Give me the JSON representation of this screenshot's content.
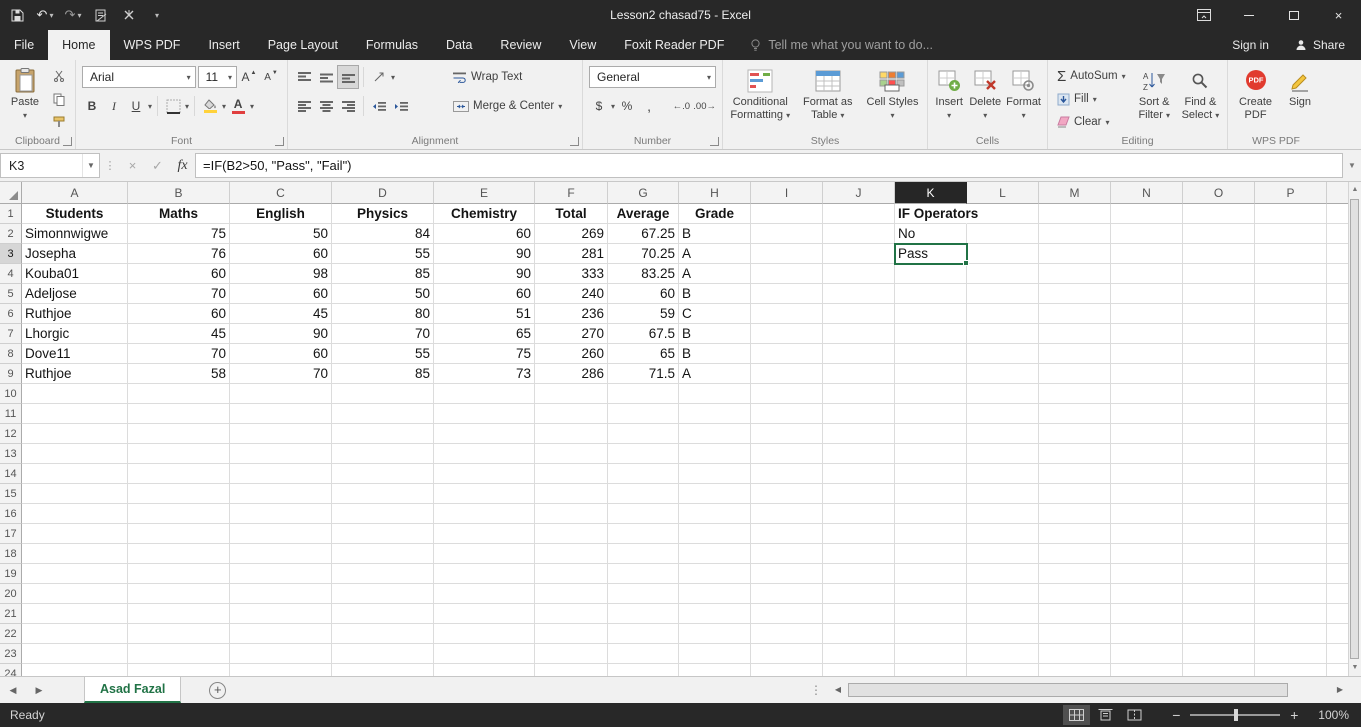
{
  "colors": {
    "accent_green": "#217346",
    "title_bar": "#282828",
    "ribbon_background": "#f1f1f1",
    "selected_column_header": "#262626",
    "selection_border": "#217346"
  },
  "titlebar": {
    "title": "Lesson2 chasad75 - Excel"
  },
  "menu": {
    "tabs": [
      {
        "label": "File"
      },
      {
        "label": "Home",
        "active": true
      },
      {
        "label": "WPS PDF"
      },
      {
        "label": "Insert"
      },
      {
        "label": "Page Layout"
      },
      {
        "label": "Formulas"
      },
      {
        "label": "Data"
      },
      {
        "label": "Review"
      },
      {
        "label": "View"
      },
      {
        "label": "Foxit Reader PDF"
      }
    ],
    "tell_me": "Tell me what you want to do...",
    "sign_in": "Sign in",
    "share": "Share"
  },
  "ribbon": {
    "groups": {
      "clipboard": {
        "label": "Clipboard",
        "paste": "Paste"
      },
      "font": {
        "label": "Font",
        "font_name": "Arial",
        "font_size": "11"
      },
      "alignment": {
        "label": "Alignment",
        "wrap_text": "Wrap Text",
        "merge_center": "Merge & Center"
      },
      "number": {
        "label": "Number",
        "format": "General"
      },
      "styles": {
        "label": "Styles",
        "conditional_formatting": "Conditional Formatting",
        "format_as_table": "Format as Table",
        "cell_styles": "Cell Styles"
      },
      "cells": {
        "label": "Cells",
        "insert": "Insert",
        "delete": "Delete",
        "format": "Format"
      },
      "editing": {
        "label": "Editing",
        "autosum": "AutoSum",
        "fill": "Fill",
        "clear": "Clear",
        "sort_filter": "Sort & Filter",
        "find_select": "Find & Select"
      },
      "wps": {
        "label": "WPS PDF",
        "create_pdf": "Create PDF",
        "sign": "Sign"
      }
    }
  },
  "formula_bar": {
    "name_box": "K3",
    "formula": "=IF(B2>50, \"Pass\", \"Fail\")"
  },
  "sheet": {
    "columns": [
      "A",
      "B",
      "C",
      "D",
      "E",
      "F",
      "G",
      "H",
      "I",
      "J",
      "K",
      "L",
      "M",
      "N",
      "O",
      "P"
    ],
    "visible_rows": 24,
    "selection": {
      "active_cell": "K3",
      "column": "K",
      "row": 3
    },
    "cells": [
      {
        "r": 1,
        "c": "A",
        "v": "Students",
        "a": "c",
        "b": true
      },
      {
        "r": 1,
        "c": "B",
        "v": "Maths",
        "a": "c",
        "b": true
      },
      {
        "r": 1,
        "c": "C",
        "v": "English",
        "a": "c",
        "b": true
      },
      {
        "r": 1,
        "c": "D",
        "v": "Physics",
        "a": "c",
        "b": true
      },
      {
        "r": 1,
        "c": "E",
        "v": "Chemistry",
        "a": "c",
        "b": true
      },
      {
        "r": 1,
        "c": "F",
        "v": "Total",
        "a": "c",
        "b": true
      },
      {
        "r": 1,
        "c": "G",
        "v": "Average",
        "a": "c",
        "b": true
      },
      {
        "r": 1,
        "c": "H",
        "v": "Grade",
        "a": "c",
        "b": true
      },
      {
        "r": 1,
        "c": "K",
        "v": "IF Operators",
        "a": "l",
        "b": true,
        "spill": true
      },
      {
        "r": 2,
        "c": "A",
        "v": "Simonnwigwe",
        "a": "l"
      },
      {
        "r": 2,
        "c": "B",
        "v": "75",
        "a": "r"
      },
      {
        "r": 2,
        "c": "C",
        "v": "50",
        "a": "r"
      },
      {
        "r": 2,
        "c": "D",
        "v": "84",
        "a": "r"
      },
      {
        "r": 2,
        "c": "E",
        "v": "60",
        "a": "r"
      },
      {
        "r": 2,
        "c": "F",
        "v": "269",
        "a": "r"
      },
      {
        "r": 2,
        "c": "G",
        "v": "67.25",
        "a": "r"
      },
      {
        "r": 2,
        "c": "H",
        "v": "B",
        "a": "l"
      },
      {
        "r": 2,
        "c": "K",
        "v": "No",
        "a": "l"
      },
      {
        "r": 3,
        "c": "A",
        "v": "Josepha",
        "a": "l"
      },
      {
        "r": 3,
        "c": "B",
        "v": "76",
        "a": "r"
      },
      {
        "r": 3,
        "c": "C",
        "v": "60",
        "a": "r"
      },
      {
        "r": 3,
        "c": "D",
        "v": "55",
        "a": "r"
      },
      {
        "r": 3,
        "c": "E",
        "v": "90",
        "a": "r"
      },
      {
        "r": 3,
        "c": "F",
        "v": "281",
        "a": "r"
      },
      {
        "r": 3,
        "c": "G",
        "v": "70.25",
        "a": "r"
      },
      {
        "r": 3,
        "c": "H",
        "v": "A",
        "a": "l"
      },
      {
        "r": 3,
        "c": "K",
        "v": "Pass",
        "a": "l"
      },
      {
        "r": 4,
        "c": "A",
        "v": "Kouba01",
        "a": "l"
      },
      {
        "r": 4,
        "c": "B",
        "v": "60",
        "a": "r"
      },
      {
        "r": 4,
        "c": "C",
        "v": "98",
        "a": "r"
      },
      {
        "r": 4,
        "c": "D",
        "v": "85",
        "a": "r"
      },
      {
        "r": 4,
        "c": "E",
        "v": "90",
        "a": "r"
      },
      {
        "r": 4,
        "c": "F",
        "v": "333",
        "a": "r"
      },
      {
        "r": 4,
        "c": "G",
        "v": "83.25",
        "a": "r"
      },
      {
        "r": 4,
        "c": "H",
        "v": "A",
        "a": "l"
      },
      {
        "r": 5,
        "c": "A",
        "v": "Adeljose",
        "a": "l"
      },
      {
        "r": 5,
        "c": "B",
        "v": "70",
        "a": "r"
      },
      {
        "r": 5,
        "c": "C",
        "v": "60",
        "a": "r"
      },
      {
        "r": 5,
        "c": "D",
        "v": "50",
        "a": "r"
      },
      {
        "r": 5,
        "c": "E",
        "v": "60",
        "a": "r"
      },
      {
        "r": 5,
        "c": "F",
        "v": "240",
        "a": "r"
      },
      {
        "r": 5,
        "c": "G",
        "v": "60",
        "a": "r"
      },
      {
        "r": 5,
        "c": "H",
        "v": "B",
        "a": "l"
      },
      {
        "r": 6,
        "c": "A",
        "v": "Ruthjoe",
        "a": "l"
      },
      {
        "r": 6,
        "c": "B",
        "v": "60",
        "a": "r"
      },
      {
        "r": 6,
        "c": "C",
        "v": "45",
        "a": "r"
      },
      {
        "r": 6,
        "c": "D",
        "v": "80",
        "a": "r"
      },
      {
        "r": 6,
        "c": "E",
        "v": "51",
        "a": "r"
      },
      {
        "r": 6,
        "c": "F",
        "v": "236",
        "a": "r"
      },
      {
        "r": 6,
        "c": "G",
        "v": "59",
        "a": "r"
      },
      {
        "r": 6,
        "c": "H",
        "v": "C",
        "a": "l"
      },
      {
        "r": 7,
        "c": "A",
        "v": "Lhorgic",
        "a": "l"
      },
      {
        "r": 7,
        "c": "B",
        "v": "45",
        "a": "r"
      },
      {
        "r": 7,
        "c": "C",
        "v": "90",
        "a": "r"
      },
      {
        "r": 7,
        "c": "D",
        "v": "70",
        "a": "r"
      },
      {
        "r": 7,
        "c": "E",
        "v": "65",
        "a": "r"
      },
      {
        "r": 7,
        "c": "F",
        "v": "270",
        "a": "r"
      },
      {
        "r": 7,
        "c": "G",
        "v": "67.5",
        "a": "r"
      },
      {
        "r": 7,
        "c": "H",
        "v": "B",
        "a": "l"
      },
      {
        "r": 8,
        "c": "A",
        "v": "Dove11",
        "a": "l"
      },
      {
        "r": 8,
        "c": "B",
        "v": "70",
        "a": "r"
      },
      {
        "r": 8,
        "c": "C",
        "v": "60",
        "a": "r"
      },
      {
        "r": 8,
        "c": "D",
        "v": "55",
        "a": "r"
      },
      {
        "r": 8,
        "c": "E",
        "v": "75",
        "a": "r"
      },
      {
        "r": 8,
        "c": "F",
        "v": "260",
        "a": "r"
      },
      {
        "r": 8,
        "c": "G",
        "v": "65",
        "a": "r"
      },
      {
        "r": 8,
        "c": "H",
        "v": "B",
        "a": "l"
      },
      {
        "r": 9,
        "c": "A",
        "v": "Ruthjoe",
        "a": "l"
      },
      {
        "r": 9,
        "c": "B",
        "v": "58",
        "a": "r"
      },
      {
        "r": 9,
        "c": "C",
        "v": "70",
        "a": "r"
      },
      {
        "r": 9,
        "c": "D",
        "v": "85",
        "a": "r"
      },
      {
        "r": 9,
        "c": "E",
        "v": "73",
        "a": "r"
      },
      {
        "r": 9,
        "c": "F",
        "v": "286",
        "a": "r"
      },
      {
        "r": 9,
        "c": "G",
        "v": "71.5",
        "a": "r"
      },
      {
        "r": 9,
        "c": "H",
        "v": "A",
        "a": "l"
      }
    ]
  },
  "sheet_tabs": {
    "active_tab": "Asad Fazal"
  },
  "status_bar": {
    "mode": "Ready",
    "zoom_level": "100%"
  }
}
